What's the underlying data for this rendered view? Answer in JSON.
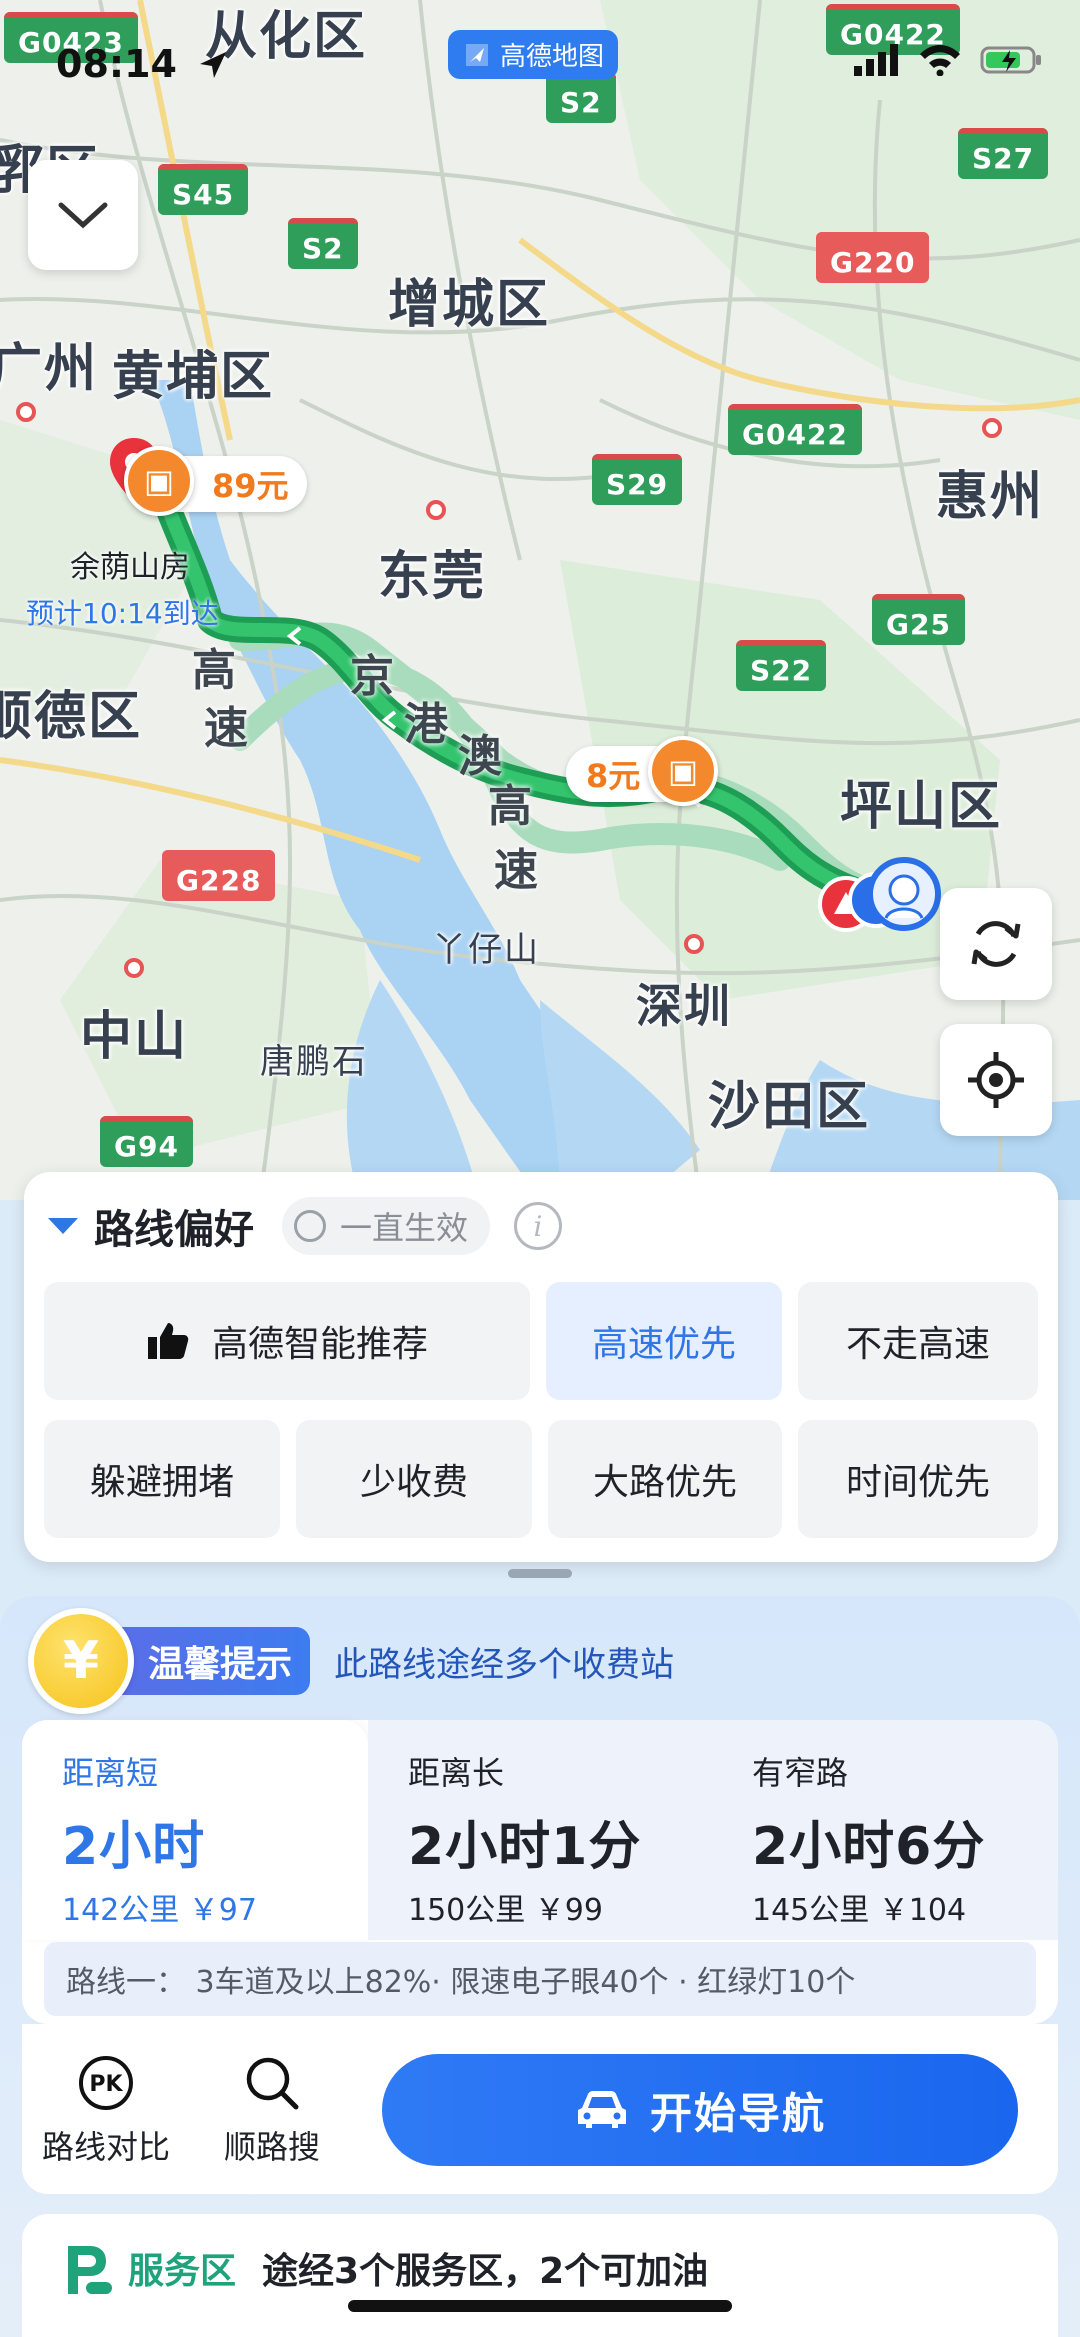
{
  "status_bar": {
    "time": "08:14"
  },
  "app_badge": {
    "label": "高德地图"
  },
  "map": {
    "districts": {
      "conghua": "从化区",
      "zengcheng": "增城区",
      "huangpu": "黄埔区",
      "guangzhou_partial": "广州",
      "dongguan": "东莞",
      "huizhou": "惠州",
      "shunde": "顺德区",
      "pingshan": "坪山区",
      "zhongshan": "中山",
      "tangpengshi": "唐鹏石",
      "yazaishan": "丫仔山",
      "shenzhen": "深圳",
      "shatian": "沙田区",
      "west_partial": "郛区"
    },
    "highways": {
      "g0423": "G0423",
      "g0422_top": "G0422",
      "s2_top": "S2",
      "s27": "S27",
      "s45": "S45",
      "s2": "S2",
      "g220": "G220",
      "g0422": "G0422",
      "s29": "S29",
      "g25": "G25",
      "s22": "S22",
      "g228": "G228",
      "g94": "G94"
    },
    "route_labels": {
      "gaosu": [
        "高",
        "速"
      ],
      "jinggangao": [
        "京",
        "港",
        "澳",
        "高",
        "速"
      ]
    },
    "tolls": [
      {
        "amount": "89元"
      },
      {
        "amount": "8元"
      }
    ],
    "destination": {
      "name": "余荫山房",
      "eta": "预计10:14到达"
    }
  },
  "route_preference": {
    "title": "路线偏好",
    "always_apply": "一直生效",
    "options": [
      {
        "label": "高德智能推荐",
        "active": false
      },
      {
        "label": "高速优先",
        "active": true
      },
      {
        "label": "不走高速",
        "active": false
      },
      {
        "label": "躲避拥堵",
        "active": false
      },
      {
        "label": "少收费",
        "active": false
      },
      {
        "label": "大路优先",
        "active": false
      },
      {
        "label": "时间优先",
        "active": false
      }
    ]
  },
  "tip": {
    "badge": "温馨提示",
    "text": "此路线途经多个收费站",
    "coin": "¥"
  },
  "routes": [
    {
      "tag": "距离短",
      "time": "2小时",
      "meta": "142公里 ￥97",
      "active": true
    },
    {
      "tag": "距离长",
      "time": "2小时1分",
      "meta": "150公里 ￥99",
      "active": false
    },
    {
      "tag": "有窄路",
      "time": "2小时6分",
      "meta": "145公里 ￥104",
      "active": false
    }
  ],
  "route_detail": "路线一： 3车道及以上82%· 限速电子眼40个 · 红绿灯10个",
  "actions": {
    "compare": "路线对比",
    "compare_icon": "PK",
    "along_search": "顺路搜",
    "start_nav": "开始导航"
  },
  "service": {
    "label": "服务区",
    "text": "途经3个服务区，2个可加油"
  }
}
